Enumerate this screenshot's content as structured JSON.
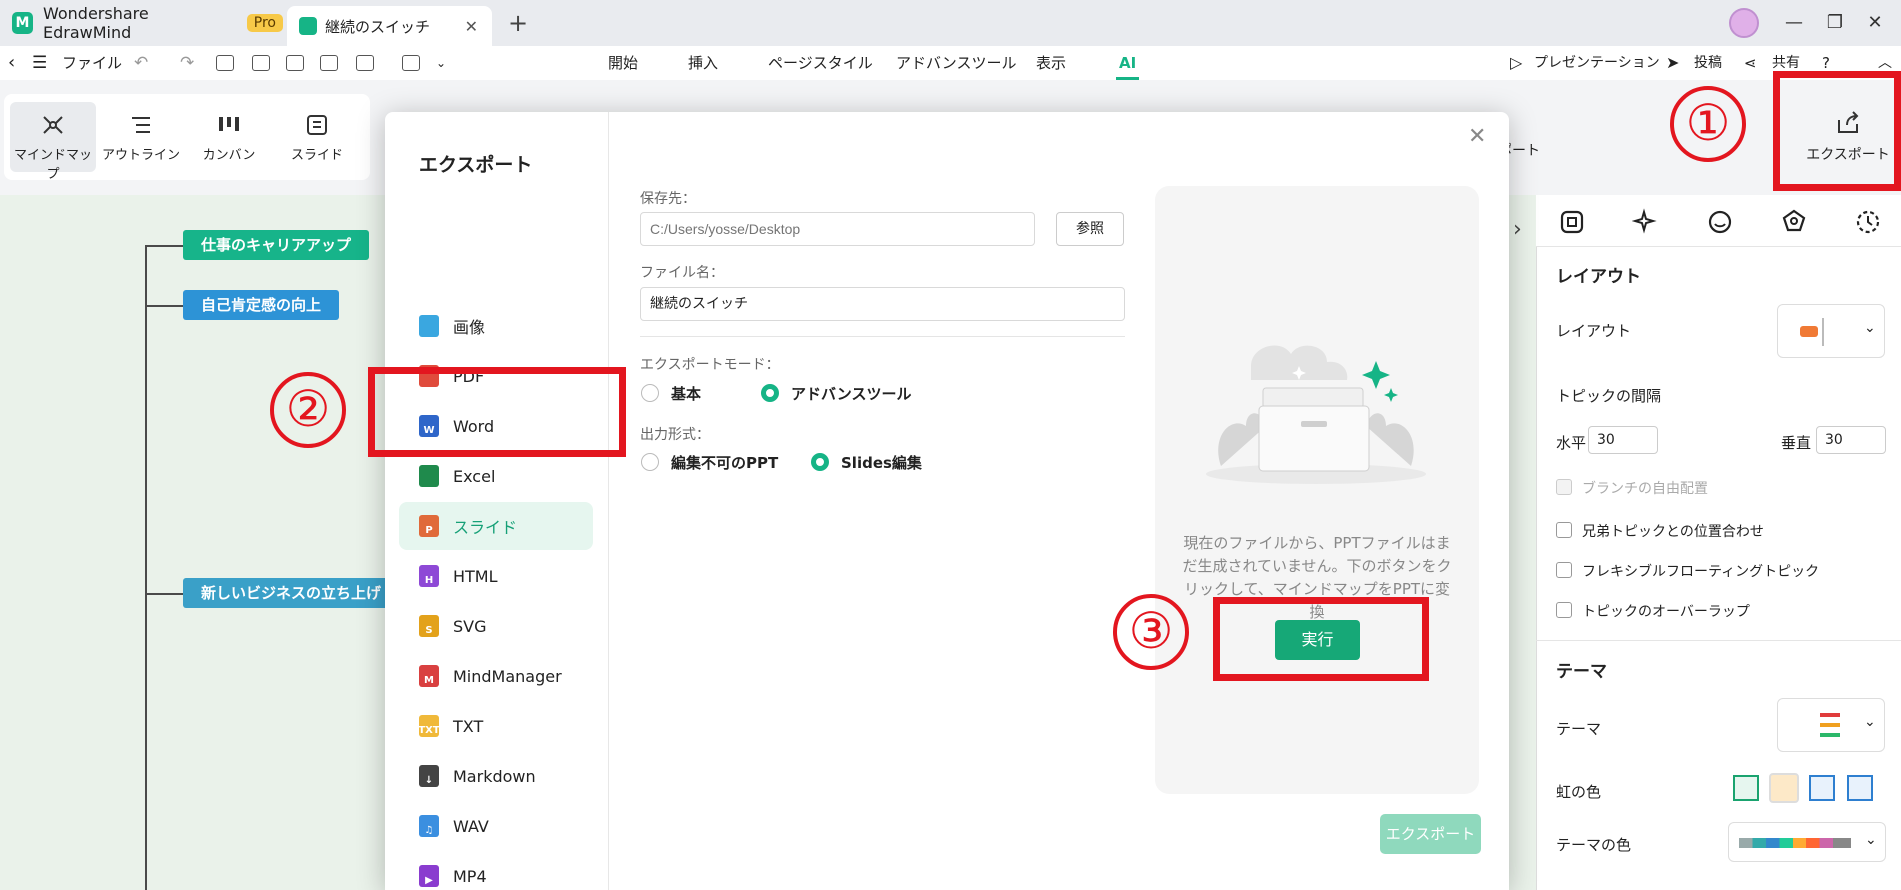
{
  "titlebar": {
    "app_name": "Wondershare EdrawMind",
    "pro_badge": "Pro",
    "doc_tab": "継続のスイッチ"
  },
  "menubar": {
    "file": "ファイル",
    "tabs": [
      "開始",
      "挿入",
      "ページスタイル",
      "アドバンスツール",
      "表示",
      "AI"
    ],
    "active_tab": "AI",
    "presentation": "プレゼンテーション",
    "post": "投稿",
    "share": "共有"
  },
  "ribbon": {
    "views": [
      "マインドマップ",
      "アウトライン",
      "カンバン",
      "スライド"
    ],
    "selected_view": "マインドマップ",
    "partial_label": "ポート",
    "export_label": "エクスポート"
  },
  "canvas": {
    "topics": [
      {
        "text": "仕事のキャリアアップ",
        "color": "#17b48a"
      },
      {
        "text": "自己肯定感の向上",
        "color": "#2d93d6"
      },
      {
        "text": "新しいビジネスの立ち上げ",
        "color": "#3aa0c8"
      }
    ]
  },
  "panel": {
    "layout_heading": "レイアウト",
    "layout_label": "レイアウト",
    "topic_spacing": "トピックの間隔",
    "horizontal": "水平",
    "horizontal_value": "30",
    "vertical": "垂直",
    "vertical_value": "30",
    "options": [
      {
        "label": "ブランチの自由配置",
        "disabled": true
      },
      {
        "label": "兄弟トピックとの位置合わせ",
        "disabled": false
      },
      {
        "label": "フレキシブルフローティングトピック",
        "disabled": false
      },
      {
        "label": "トピックのオーバーラップ",
        "disabled": false
      }
    ],
    "theme_heading": "テーマ",
    "theme_label": "テーマ",
    "rainbow_label": "虹の色",
    "theme_color_label": "テーマの色"
  },
  "dialog": {
    "title": "エクスポート",
    "formats": [
      "画像",
      "PDF",
      "Word",
      "Excel",
      "スライド",
      "HTML",
      "SVG",
      "MindManager",
      "TXT",
      "Markdown",
      "WAV",
      "MP4"
    ],
    "format_colors": [
      "#3aa7e0",
      "#e04b3c",
      "#2f66c9",
      "#1f8a4c",
      "#e06a3a",
      "#8e49d6",
      "#e3a21b",
      "#d94040",
      "#f0b93a",
      "#444444",
      "#3b8fe0",
      "#8a3ccf"
    ],
    "selected_format": "スライド",
    "save_to_label": "保存先：",
    "save_to_placeholder": "C:/Users/yosse/Desktop",
    "browse": "参照",
    "filename_label": "ファイル名：",
    "filename_value": "継続のスイッチ",
    "mode_label": "エクスポートモード：",
    "mode_options": [
      "基本",
      "アドバンスツール"
    ],
    "mode_selected": "アドバンスツール",
    "output_label": "出力形式：",
    "output_options": [
      "編集不可のPPT",
      "Slides編集"
    ],
    "output_selected": "Slides編集",
    "preview_text": "現在のファイルから、PPTファイルはまだ生成されていません。下のボタンをクリックして、マインドマップをPPTに変換",
    "run_button": "実行",
    "export_button": "エクスポート"
  },
  "annotations": {
    "step1": "①",
    "step2": "②",
    "step3": "③",
    "color": "#e3161f"
  }
}
